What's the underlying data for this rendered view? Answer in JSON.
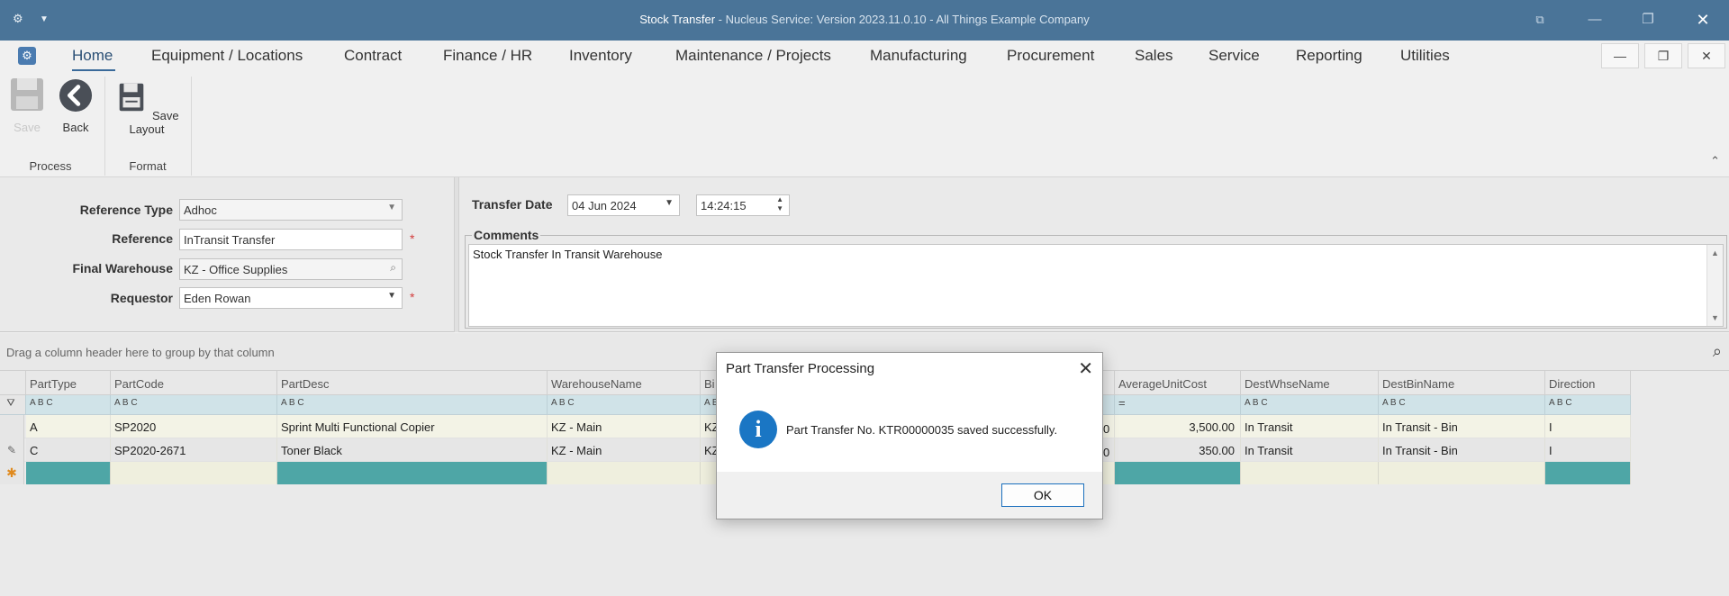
{
  "titlebar": {
    "title_main": "Stock Transfer",
    "title_rest": " - Nucleus Service: Version 2023.11.0.10 - All Things Example Company"
  },
  "menu": {
    "items": [
      "Home",
      "Equipment / Locations",
      "Contract",
      "Finance / HR",
      "Inventory",
      "Maintenance / Projects",
      "Manufacturing",
      "Procurement",
      "Sales",
      "Service",
      "Reporting",
      "Utilities"
    ],
    "active": "Home"
  },
  "ribbon": {
    "save_label": "Save",
    "back_label": "Back",
    "save_layout_label": "Save Layout",
    "group_process": "Process",
    "group_format": "Format"
  },
  "form": {
    "reference_type_label": "Reference Type",
    "reference_type_value": "Adhoc",
    "reference_label": "Reference",
    "reference_value": "InTransit Transfer",
    "final_warehouse_label": "Final Warehouse",
    "final_warehouse_value": "KZ - Office Supplies",
    "requestor_label": "Requestor",
    "requestor_value": "Eden Rowan",
    "transfer_date_label": "Transfer Date",
    "transfer_date_value": "04 Jun 2024",
    "transfer_time_value": "14:24:15",
    "comments_label": "Comments",
    "comments_value": "Stock Transfer In Transit Warehouse",
    "required_mark": "*"
  },
  "grid": {
    "group_hint": "Drag a column header here to group by that column",
    "columns": [
      "PartType",
      "PartCode",
      "PartDesc",
      "WarehouseName",
      "Bi",
      "AverageUnitCost",
      "DestWhseName",
      "DestBinName",
      "Direction"
    ],
    "filter_icon_text": "A B C",
    "rows": [
      {
        "PartType": "A",
        "PartCode": "SP2020",
        "PartDesc": "Sprint Multi Functional Copier",
        "WarehouseName": "KZ - Main",
        "Bi": "KZ",
        "Hidden": "0",
        "AverageUnitCost": "3,500.00",
        "DestWhseName": "In Transit",
        "DestBinName": "In Transit - Bin",
        "Direction": "I"
      },
      {
        "PartType": "C",
        "PartCode": "SP2020-2671",
        "PartDesc": "Toner Black",
        "WarehouseName": "KZ - Main",
        "Bi": "KZ",
        "Hidden": "0",
        "AverageUnitCost": "350.00",
        "DestWhseName": "In Transit",
        "DestBinName": "In Transit - Bin",
        "Direction": "I"
      }
    ]
  },
  "dialog": {
    "title": "Part Transfer Processing",
    "message": "Part Transfer No. KTR00000035 saved successfully.",
    "ok_label": "OK"
  },
  "colors": {
    "titlebar": "#4a7498",
    "accent": "#1a76c4",
    "new_row_teal": "#4ea6a6"
  }
}
